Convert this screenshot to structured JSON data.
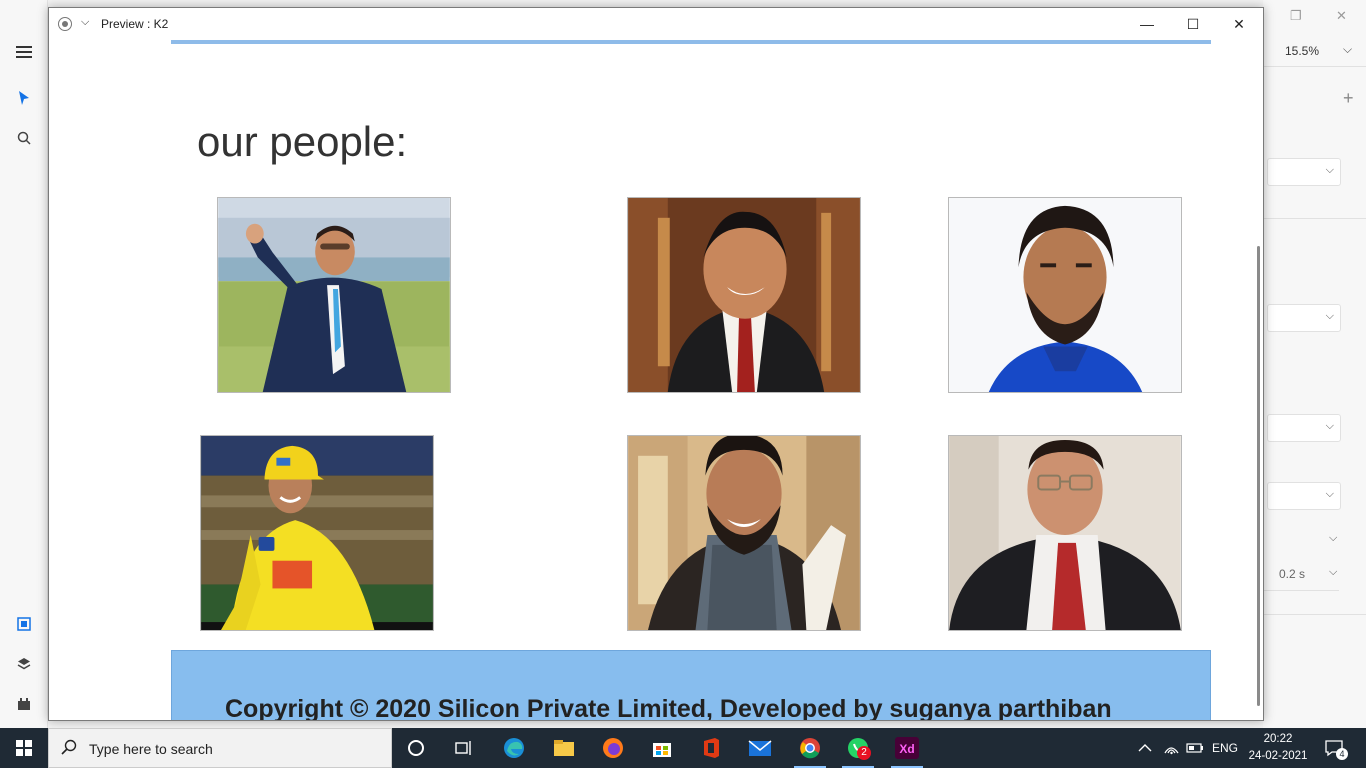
{
  "preview_window": {
    "title": "Preview : K2",
    "minimize_icon": "minimize-icon",
    "maximize_icon": "maximize-icon",
    "close_icon": "close-icon"
  },
  "page": {
    "heading": "our people:",
    "people_photos": [
      {
        "name": "photo-1",
        "subject": "man in navy suit waving on cricket ground"
      },
      {
        "name": "photo-2",
        "subject": "smiling man in dark suit and red tie"
      },
      {
        "name": "photo-3",
        "subject": "bearded man in blue jersey"
      },
      {
        "name": "photo-4",
        "subject": "cricketer in yellow jersey and cap"
      },
      {
        "name": "photo-5",
        "subject": "bearded man in checked shirt and blazer"
      },
      {
        "name": "photo-6",
        "subject": "man with glasses in suit and red tie"
      }
    ],
    "footer_text": "Copyright © 2020 Silicon Private Limited, Developed by suganya parthiban",
    "accent_color": "#87bdee"
  },
  "xd_app": {
    "zoom": "15.5%",
    "transition_duration": "0.2 s"
  },
  "taskbar": {
    "search_placeholder": "Type here to search",
    "language": "ENG",
    "time": "20:22",
    "date": "24-02-2021",
    "whatsapp_badge": "2",
    "notification_count": "4"
  }
}
